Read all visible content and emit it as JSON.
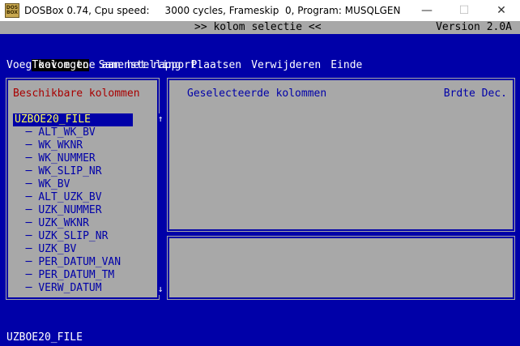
{
  "window": {
    "title": "DOSBox 0.74, Cpu speed:     3000 cycles, Frameskip  0, Program: MUSQLGEN",
    "icon_text": "DOS BOX",
    "minimize_glyph": "—",
    "maximize_glyph": "☐",
    "close_glyph": "✕"
  },
  "dos": {
    "program_title": ">> kolom selectie <<",
    "version": "Version 2.0A",
    "menu": [
      {
        "label": "Toevoegen",
        "active": true
      },
      {
        "label": "Samenstelling",
        "active": false
      },
      {
        "label": "Plaatsen",
        "active": false
      },
      {
        "label": "Verwijderen",
        "active": false
      },
      {
        "label": "Einde",
        "active": false
      }
    ],
    "hint": "Voeg kolom toe aan het rapport.",
    "left_panel": {
      "header": "Beschikbare kolommen",
      "root": "UZBOE20_FILE",
      "items": [
        "ALT_WK_BV",
        "WK_WKNR",
        "WK_NUMMER",
        "WK_SLIP_NR",
        "WK_BV",
        "ALT_UZK_BV",
        "UZK_NUMMER",
        "UZK_WKNR",
        "UZK_SLIP_NR",
        "UZK_BV",
        "PER_DATUM_VAN",
        "PER_DATUM_TM",
        "VERW_DATUM"
      ],
      "scroll_up_glyph": "↑",
      "scroll_down_glyph": "↓"
    },
    "right_panel": {
      "header": "Geselecteerde kolommen",
      "columns_header": "Brdte Dec."
    },
    "status": "UZBOE20_FILE"
  },
  "colors": {
    "dos_blue": "#0000a8",
    "dos_gray": "#a8a8a8",
    "header_red": "#a80000",
    "highlight_yellow": "#ffff55"
  }
}
